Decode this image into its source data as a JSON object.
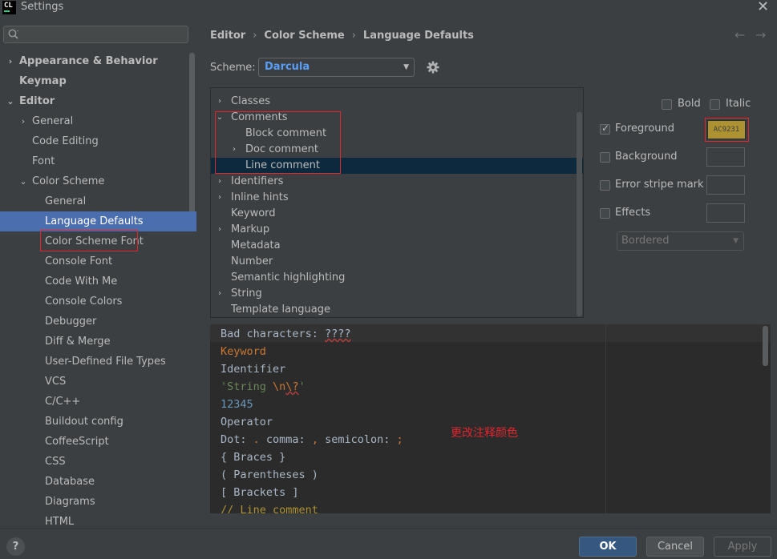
{
  "window": {
    "app_logo": "CL",
    "title": "Settings",
    "close_glyph": "✕"
  },
  "search": {
    "placeholder": ""
  },
  "sidebar": {
    "items": [
      {
        "label": "Appearance & Behavior",
        "chevron": "›"
      },
      {
        "label": "Keymap"
      },
      {
        "label": "Editor",
        "chevron": "⌄"
      },
      {
        "label": "General",
        "chevron": "›"
      },
      {
        "label": "Code Editing"
      },
      {
        "label": "Font"
      },
      {
        "label": "Color Scheme",
        "chevron": "⌄"
      },
      {
        "label": "General"
      },
      {
        "label": "Language Defaults"
      },
      {
        "label": "Color Scheme Font"
      },
      {
        "label": "Console Font"
      },
      {
        "label": "Code With Me"
      },
      {
        "label": "Console Colors"
      },
      {
        "label": "Debugger"
      },
      {
        "label": "Diff & Merge"
      },
      {
        "label": "User-Defined File Types"
      },
      {
        "label": "VCS"
      },
      {
        "label": "C/C++"
      },
      {
        "label": "Buildout config"
      },
      {
        "label": "CoffeeScript"
      },
      {
        "label": "CSS"
      },
      {
        "label": "Database"
      },
      {
        "label": "Diagrams"
      },
      {
        "label": "HTML"
      }
    ]
  },
  "breadcrumb": {
    "items": [
      "Editor",
      "Color Scheme",
      "Language Defaults"
    ],
    "separator": "›"
  },
  "nav": {
    "back": "←",
    "forward": "→"
  },
  "scheme": {
    "label": "Scheme:",
    "value": "Darcula",
    "arrow": "▼"
  },
  "categories": {
    "items": [
      {
        "label": "Classes",
        "chevron": "›"
      },
      {
        "label": "Comments",
        "chevron": "⌄"
      },
      {
        "label": "Block comment"
      },
      {
        "label": "Doc comment",
        "chevron": "›"
      },
      {
        "label": "Line comment"
      },
      {
        "label": "Identifiers",
        "chevron": "›"
      },
      {
        "label": "Inline hints",
        "chevron": "›"
      },
      {
        "label": "Keyword"
      },
      {
        "label": "Markup",
        "chevron": "›"
      },
      {
        "label": "Metadata"
      },
      {
        "label": "Number"
      },
      {
        "label": "Semantic highlighting"
      },
      {
        "label": "String",
        "chevron": "›"
      },
      {
        "label": "Template language"
      }
    ]
  },
  "attributes": {
    "bold_label": "Bold",
    "italic_label": "Italic",
    "foreground_label": "Foreground",
    "foreground_color": "AC9231",
    "background_label": "Background",
    "error_stripe_label": "Error stripe mark",
    "effects_label": "Effects",
    "effects_value": "Bordered",
    "effects_arrow": "▼"
  },
  "preview": {
    "lines": {
      "bad_prefix": "Bad characters: ",
      "bad_value": "????",
      "keyword": "Keyword",
      "identifier": "Identifier",
      "string_open": "'String ",
      "string_escape": "\\n",
      "string_invalid": "\\?",
      "string_close": "'",
      "number": "12345",
      "operator": "Operator",
      "dot_prefix": "Dot: ",
      "dot": ".",
      "comma_label": " comma: ",
      "comma": ",",
      "semicolon_label": " semicolon: ",
      "semicolon": ";",
      "braces": "{ Braces }",
      "parentheses": "( Parentheses )",
      "brackets": "[ Brackets ]",
      "line_comment": "// Line comment"
    },
    "colors": {
      "default": "#a9b7c6",
      "keyword": "#cc7832",
      "string": "#6a8759",
      "number": "#6897bb",
      "comment": "#ac9231"
    }
  },
  "annotation": "更改注释颜色",
  "footer": {
    "help": "?",
    "ok": "OK",
    "cancel": "Cancel",
    "apply": "Apply"
  }
}
